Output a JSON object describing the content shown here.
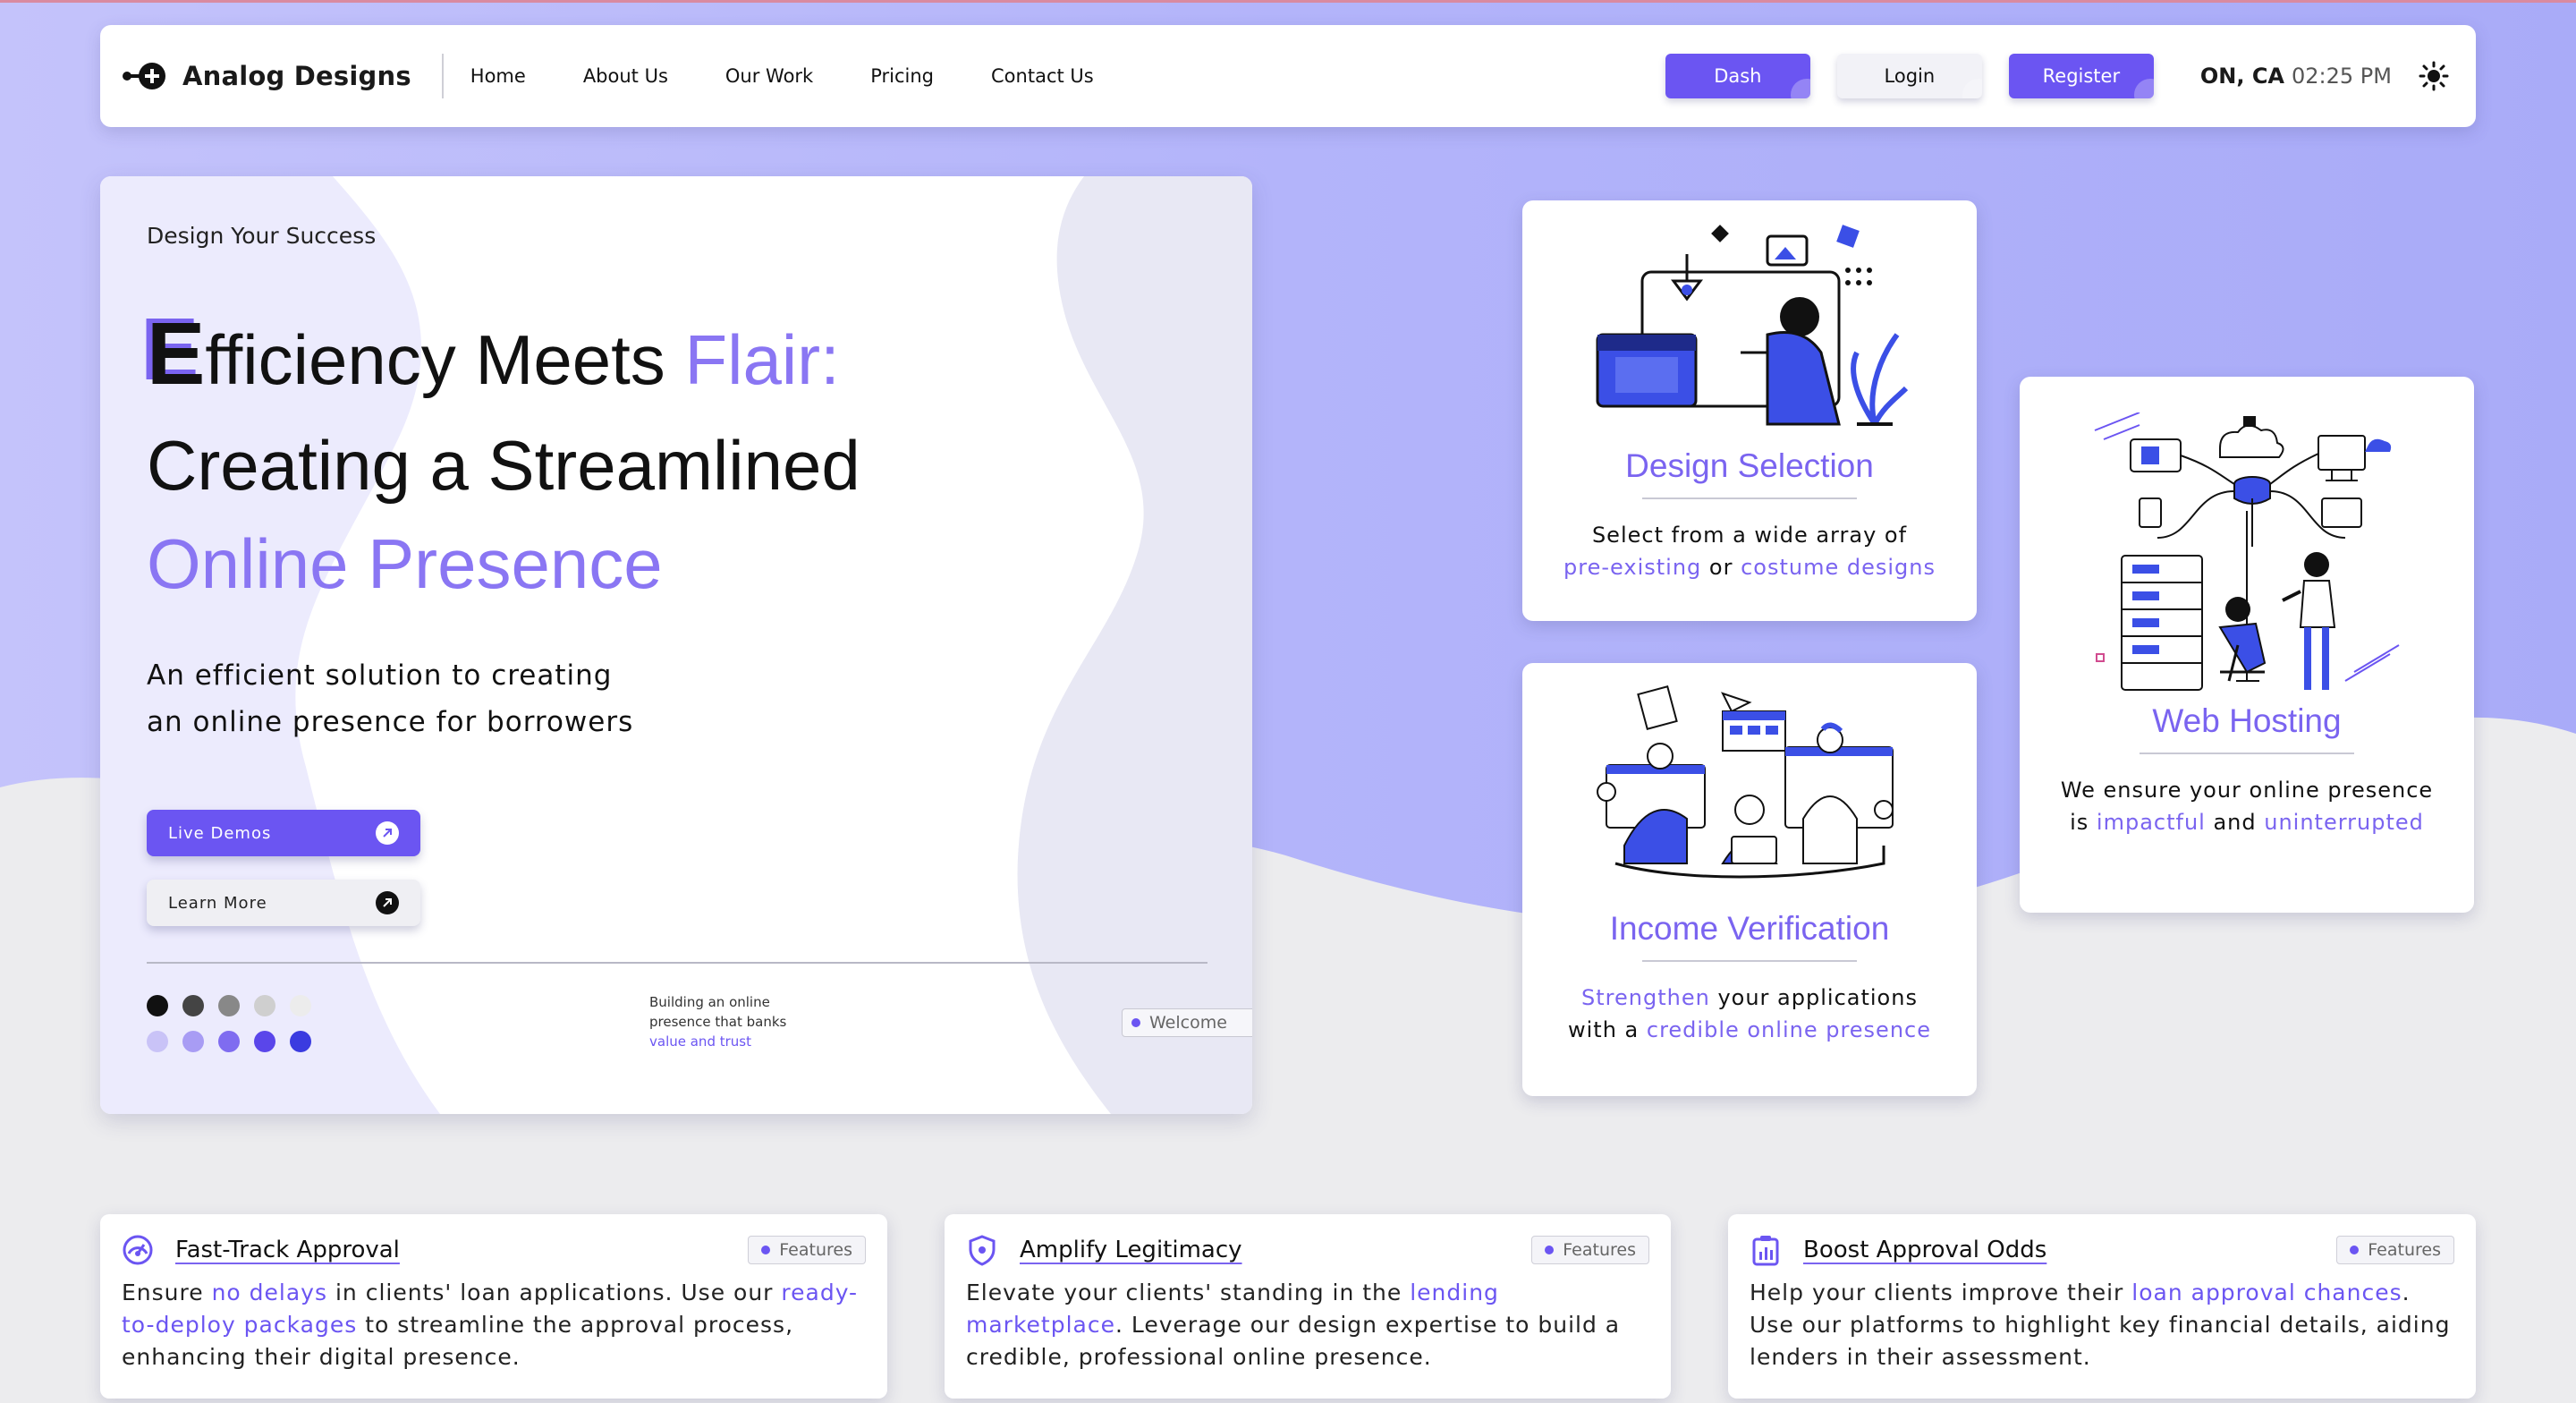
{
  "nav": {
    "brand": "Analog Designs",
    "links": [
      "Home",
      "About Us",
      "Our Work",
      "Pricing",
      "Contact Us"
    ],
    "dash_label": "Dash",
    "login_label": "Login",
    "register_label": "Register",
    "location": "ON, CA",
    "time": "02:25 PM",
    "theme_icon": "sun-icon"
  },
  "hero": {
    "eyebrow": "Design Your Success",
    "headline_letter": "E",
    "headline_line1_rest": "fficiency Meets ",
    "headline_line1_accent": "Flair:",
    "headline_line2": "Creating a Streamlined",
    "headline_line3": "Online Presence",
    "subtitle_line1": "An efficient solution to creating",
    "subtitle_line2": "an online presence for borrowers",
    "live_demos_label": "Live Demos",
    "learn_more_label": "Learn More",
    "mini_line1": "Building an online",
    "mini_line2": "presence that banks",
    "mini_line3": "value and trust",
    "welcome_label": "Welcome",
    "palette_row1": [
      "#111111",
      "#444444",
      "#888888",
      "#cfcfcf",
      "#ececec"
    ],
    "palette_row2": [
      "#c9c3f7",
      "#a89cf4",
      "#7f6cf0",
      "#5a46ea",
      "#3a3be0"
    ]
  },
  "services": {
    "design": {
      "title": "Design Selection",
      "desc_line1": "Select from a wide array of",
      "desc_accent1": "pre-existing",
      "desc_mid": " or ",
      "desc_accent2": "costume designs"
    },
    "income": {
      "title": "Income Verification",
      "desc_accent1": "Strengthen",
      "desc_rest1": " your applications",
      "desc_line2_pre": "with a ",
      "desc_accent2": "credible online presence"
    },
    "hosting": {
      "title": "Web Hosting",
      "desc_line1": "We ensure your online presence",
      "desc_line2_pre": "is ",
      "desc_accent1": "impactful",
      "desc_mid": " and ",
      "desc_accent2": "uninterrupted"
    }
  },
  "features": [
    {
      "icon": "gauge-icon",
      "title": "Fast-Track Approval",
      "tag": "Features",
      "b1": "Ensure ",
      "a1": "no delays",
      "b2": " in clients' loan applications. Use our ",
      "a2": "ready-to-deploy packages",
      "b3": " to streamline the approval process, enhancing their digital presence."
    },
    {
      "icon": "shield-icon",
      "title": "Amplify Legitimacy",
      "tag": "Features",
      "b1": "Elevate your clients' standing in the ",
      "a1": "lending marketplace",
      "b2": ". Leverage our design expertise to build a credible, professional online presence."
    },
    {
      "icon": "clipboard-chart-icon",
      "title": "Boost Approval Odds",
      "tag": "Features",
      "b1": "Help your clients improve their ",
      "a1": "loan approval chances",
      "b2": ". Use our platforms to highlight key financial details, aiding lenders in their assessment."
    }
  ],
  "colors": {
    "accent": "#6b55f2",
    "accent_text": "#7a64f0",
    "bg_wave": "#b9b9fb"
  }
}
